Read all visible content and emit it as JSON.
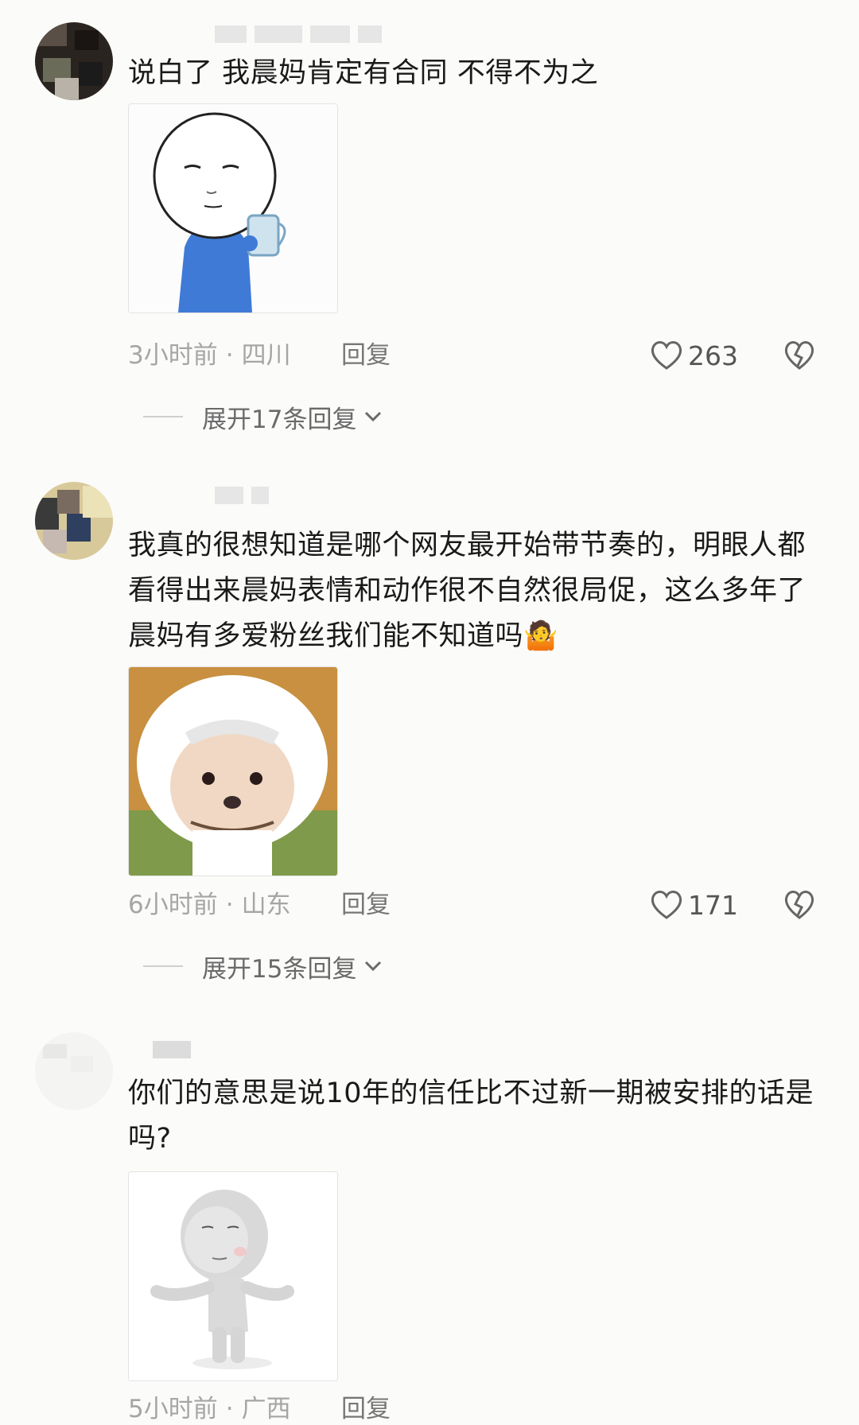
{
  "comments": [
    {
      "text": "说白了 我晨妈肯定有合同 不得不为之",
      "time": "3小时前",
      "location": "四川",
      "reply_label": "回复",
      "likes": "263",
      "expand_label": "展开17条回复"
    },
    {
      "text": "我真的很想知道是哪个网友最开始带节奏的，明眼人都看得出来晨妈表情和动作很不自然很局促，这么多年了晨妈有多爱粉丝我们能不知道吗🤷",
      "time": "6小时前",
      "location": "山东",
      "reply_label": "回复",
      "likes": "171",
      "expand_label": "展开15条回复"
    },
    {
      "text": "你们的意思是说10年的信任比不过新一期被安排的话是吗?",
      "time": "5小时前",
      "location": "广西",
      "reply_label": "回复"
    }
  ],
  "separator": "·",
  "icons": {
    "like": "heart-outline-icon",
    "dislike": "broken-heart-icon",
    "expand": "chevron-down-icon"
  },
  "colors": {
    "background": "#fbfbf9",
    "meta_text": "#a6a6a6",
    "body_text": "#1a1a1a"
  }
}
